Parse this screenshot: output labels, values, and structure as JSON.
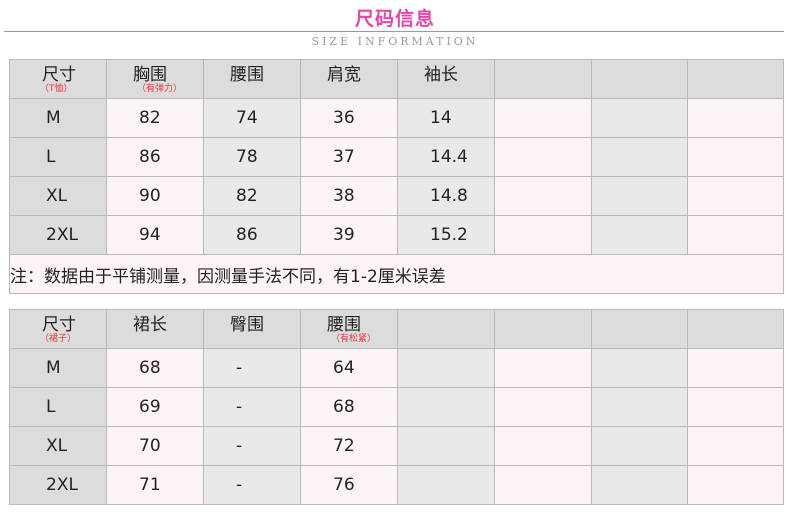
{
  "header": {
    "title": "尺码信息",
    "subtitle": "SIZE INFORMATION"
  },
  "table1": {
    "columns": [
      {
        "label": "尺寸",
        "sub": "（T恤）"
      },
      {
        "label": "胸围",
        "sub": "（有弹力）"
      },
      {
        "label": "腰围",
        "sub": ""
      },
      {
        "label": "肩宽",
        "sub": ""
      },
      {
        "label": "袖长",
        "sub": ""
      },
      {
        "label": "",
        "sub": ""
      },
      {
        "label": "",
        "sub": ""
      },
      {
        "label": "",
        "sub": ""
      }
    ],
    "rows": [
      [
        "M",
        "82",
        "74",
        "36",
        "14"
      ],
      [
        "L",
        "86",
        "78",
        "37",
        "14.4"
      ],
      [
        "XL",
        "90",
        "82",
        "38",
        "14.8"
      ],
      [
        "2XL",
        "94",
        "86",
        "39",
        "15.2"
      ]
    ],
    "note": "注：数据由于平铺测量，因测量手法不同，有1-2厘米误差"
  },
  "table2": {
    "columns": [
      {
        "label": "尺寸",
        "sub": "（裙子）"
      },
      {
        "label": "裙长",
        "sub": ""
      },
      {
        "label": "臀围",
        "sub": ""
      },
      {
        "label": "腰围",
        "sub": "（有松紧）"
      },
      {
        "label": "",
        "sub": ""
      },
      {
        "label": "",
        "sub": ""
      },
      {
        "label": "",
        "sub": ""
      },
      {
        "label": "",
        "sub": ""
      }
    ],
    "rows": [
      [
        "M",
        "68",
        "-",
        "64"
      ],
      [
        "L",
        "69",
        "-",
        "68"
      ],
      [
        "XL",
        "70",
        "-",
        "72"
      ],
      [
        "2XL",
        "71",
        "-",
        "76"
      ]
    ]
  },
  "colors": {
    "title": "#e04aa6",
    "rule": "#a989c8",
    "header_bg": "#dcdcdc",
    "cell_light": "#fdf5f5",
    "cell_grey": "#e9e9e9",
    "sub_label": "#e23a3a"
  }
}
